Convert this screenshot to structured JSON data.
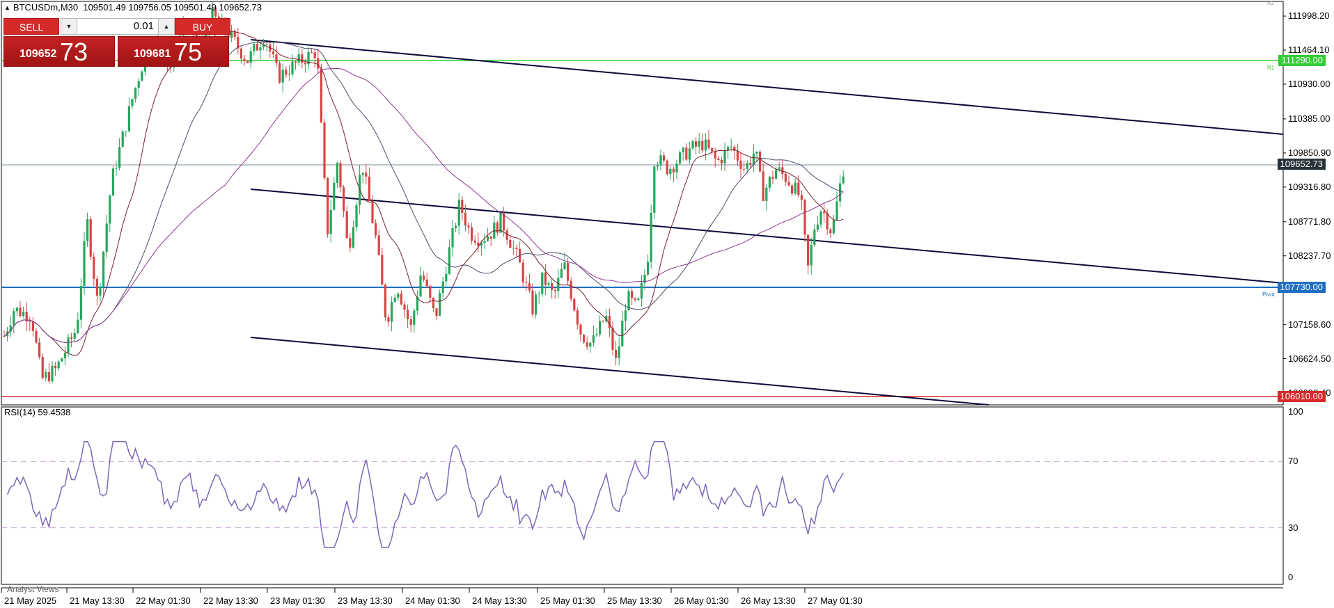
{
  "header": {
    "symbol": "BTCUSDm,M30",
    "ohlc": "109501.49 109756.05 109501.49 109652.73"
  },
  "trade_panel": {
    "sell_label": "SELL",
    "buy_label": "BUY",
    "lot": "0.01",
    "sell_small": "109652",
    "sell_big": "73",
    "buy_small": "109681",
    "buy_big": "75"
  },
  "price_axis": [
    "111998.20",
    "111464.10",
    "110930.00",
    "110385.00",
    "109850.90",
    "109316.80",
    "108771.80",
    "108237.70",
    "107158.60",
    "106624.50",
    "106090.40"
  ],
  "price_labels": {
    "current": "109652.73",
    "green_line": "111290.00",
    "blue_line": "107730.00",
    "red_line": "106010.00",
    "pivot": "Pivot",
    "r1": "R1",
    "r2": "R2"
  },
  "rsi": {
    "title": "RSI(14) 59.4538",
    "levels": [
      "100",
      "70",
      "30",
      "0"
    ]
  },
  "time_axis": [
    "21 May 2025",
    "21 May 13:30",
    "22 May 01:30",
    "22 May 13:30",
    "23 May 01:30",
    "23 May 13:30",
    "24 May 01:30",
    "24 May 13:30",
    "25 May 01:30",
    "25 May 13:30",
    "26 May 01:30",
    "26 May 13:30",
    "27 May 01:30"
  ],
  "footer": {
    "analyst": "Analyst Views"
  },
  "colors": {
    "bull": "#26a65b",
    "bear": "#d64545",
    "green_line": "#33cc33",
    "blue_line": "#1e6fc2",
    "red_line": "#d42a2a",
    "channel": "#0b0b3a",
    "rsi_line": "#7d66b8"
  }
}
